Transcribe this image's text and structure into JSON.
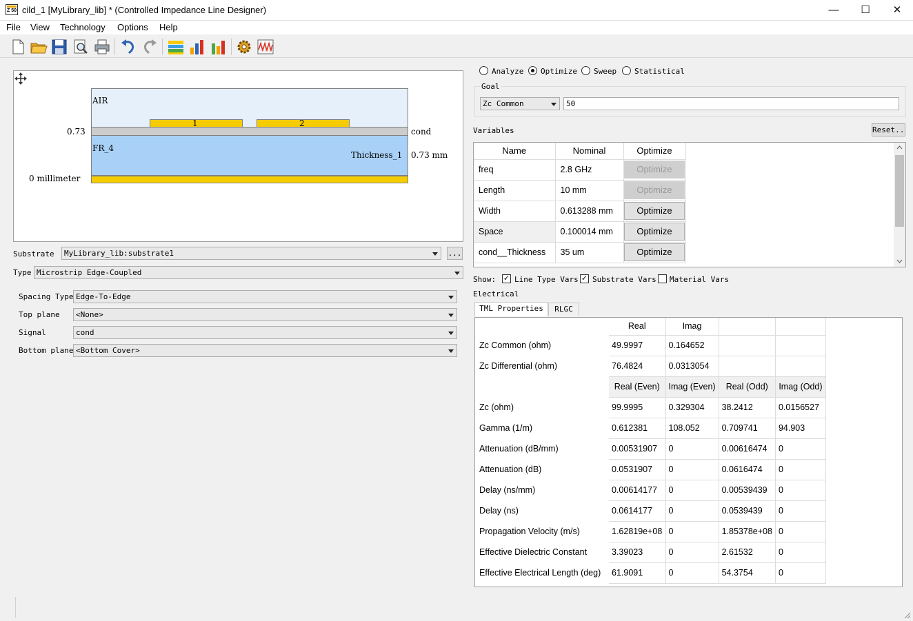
{
  "window": {
    "title": "cild_1 [MyLibrary_lib] * (Controlled Impedance Line Designer)",
    "app_icon_text": "Z 50",
    "minimize": "—",
    "maximize": "☐",
    "close": "✕"
  },
  "menu": [
    "File",
    "View",
    "Technology",
    "Options",
    "Help"
  ],
  "toolbar": [
    "new-icon",
    "open-folder-icon",
    "save-icon",
    "print-preview-icon",
    "print-icon",
    "undo-icon",
    "redo-icon",
    "substrate-layers-icon",
    "chart-icon-1",
    "chart-icon-2",
    "gear-settings-icon",
    "waveform-icon"
  ],
  "diagram": {
    "air_label": "AIR",
    "fr4_label": "FR_4",
    "cond_label": "cond",
    "thickness_label": "Thickness_1",
    "left_top_value": "0.73",
    "left_bottom_value": "0 millimeter",
    "right_value": "0.73 mm",
    "trace1_label": "1",
    "trace2_label": "2",
    "colors": {
      "air": "#e5f0fb",
      "fr4": "#a9d1f7",
      "conductor": "#f5cc00",
      "cond_layer": "#cccccc"
    }
  },
  "left_form": {
    "substrate_label": "Substrate",
    "substrate_value": "MyLibrary_lib:substrate1",
    "browse_label": "...",
    "type_label": "Type",
    "type_value": "Microstrip Edge-Coupled",
    "spacing_type_label": "Spacing Type",
    "spacing_type_value": "Edge-To-Edge",
    "top_plane_label": "Top plane",
    "top_plane_value": "<None>",
    "signal_label": "Signal",
    "signal_value": "cond",
    "bottom_plane_label": "Bottom plane",
    "bottom_plane_value": "<Bottom Cover>"
  },
  "mode": {
    "analyze": "Analyze",
    "optimize": "Optimize",
    "sweep": "Sweep",
    "statistical": "Statistical",
    "selected": "optimize"
  },
  "goal": {
    "label": "Goal",
    "target": "Zc Common",
    "value": "50"
  },
  "variables": {
    "label": "Variables",
    "reset_label": "Reset...",
    "headers": [
      "Name",
      "Nominal",
      "Optimize"
    ],
    "rows": [
      {
        "name": "freq",
        "nominal": "2.8 GHz",
        "button": "Optimize",
        "enabled": false
      },
      {
        "name": "Length",
        "nominal": "10 mm",
        "button": "Optimize",
        "enabled": false
      },
      {
        "name": "Width",
        "nominal": "0.613288 mm",
        "button": "Optimize",
        "enabled": true
      },
      {
        "name": "Space",
        "nominal": "0.100014 mm",
        "button": "Optimize",
        "enabled": true
      },
      {
        "name": "cond__Thickness",
        "nominal": "35 um",
        "button": "Optimize",
        "enabled": true
      }
    ]
  },
  "show": {
    "label": "Show:",
    "line_type_vars": "Line Type Vars",
    "substrate_vars": "Substrate Vars",
    "material_vars": "Material Vars",
    "checked_mark": "✓"
  },
  "electrical": {
    "label": "Electrical",
    "tabs": [
      "TML Properties",
      "RLGC"
    ],
    "header1": [
      "Real",
      "Imag"
    ],
    "rows1": [
      {
        "label": "Zc Common (ohm)",
        "real": "49.9997",
        "imag": "0.164652"
      },
      {
        "label": "Zc Differential (ohm)",
        "real": "76.4824",
        "imag": "0.0313054"
      }
    ],
    "header2": [
      "Real (Even)",
      "Imag (Even)",
      "Real (Odd)",
      "Imag (Odd)"
    ],
    "rows2": [
      {
        "label": "Zc (ohm)",
        "v": [
          "99.9995",
          "0.329304",
          "38.2412",
          "0.0156527"
        ]
      },
      {
        "label": "Gamma (1/m)",
        "v": [
          "0.612381",
          "108.052",
          "0.709741",
          "94.903"
        ]
      },
      {
        "label": "Attenuation (dB/mm)",
        "v": [
          "0.00531907",
          "0",
          "0.00616474",
          "0"
        ]
      },
      {
        "label": "Attenuation (dB)",
        "v": [
          "0.0531907",
          "0",
          "0.0616474",
          "0"
        ]
      },
      {
        "label": "Delay (ns/mm)",
        "v": [
          "0.00614177",
          "0",
          "0.00539439",
          "0"
        ]
      },
      {
        "label": "Delay (ns)",
        "v": [
          "0.0614177",
          "0",
          "0.0539439",
          "0"
        ]
      },
      {
        "label": "Propagation Velocity (m/s)",
        "v": [
          "1.62819e+08",
          "0",
          "1.85378e+08",
          "0"
        ]
      },
      {
        "label": "Effective Dielectric Constant",
        "v": [
          "3.39023",
          "0",
          "2.61532",
          "0"
        ]
      },
      {
        "label": "Effective Electrical Length (deg)",
        "v": [
          "61.9091",
          "0",
          "54.3754",
          "0"
        ]
      }
    ]
  }
}
